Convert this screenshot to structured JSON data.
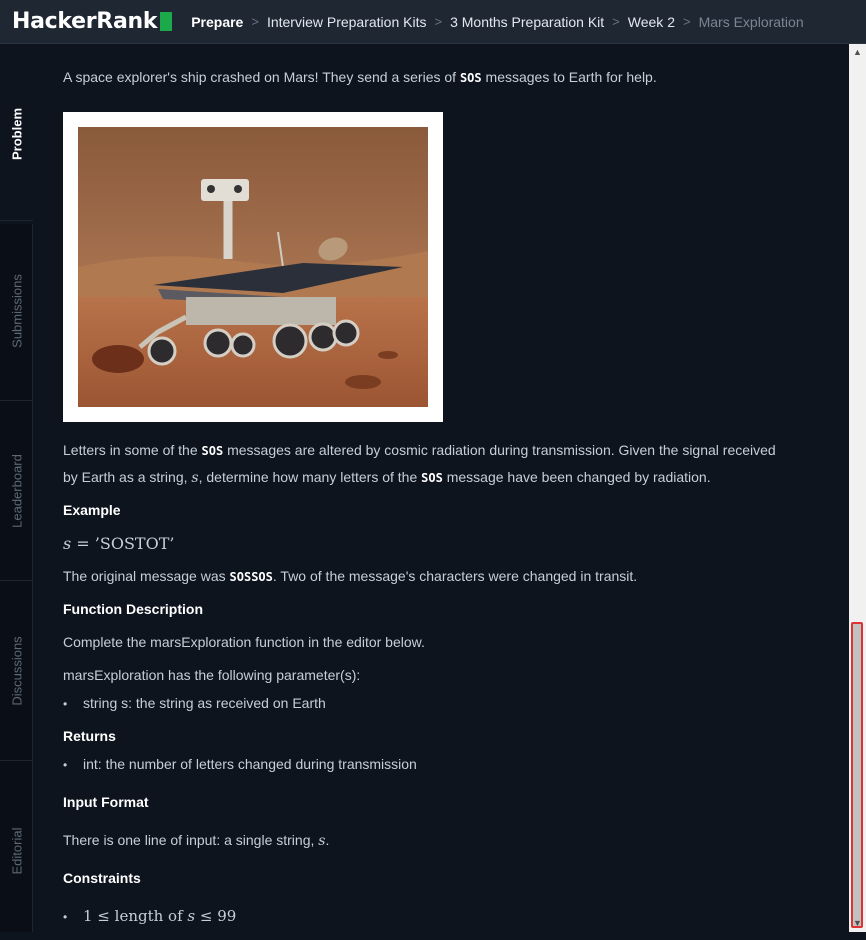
{
  "header": {
    "logo_text": "HackerRank",
    "breadcrumbs": [
      "Prepare",
      "Interview Preparation Kits",
      "3 Months Preparation Kit",
      "Week 2",
      "Mars Exploration"
    ]
  },
  "sidebar": {
    "tabs": [
      "Problem",
      "Submissions",
      "Leaderboard",
      "Discussions",
      "Editorial"
    ],
    "active": "Problem"
  },
  "problem": {
    "intro": [
      "A space explorer's ship crashed on Mars! They send a series of ",
      "SOS",
      " messages to Earth for help."
    ],
    "image_description_icon": "mars-rover-image",
    "para1_line1": [
      "Letters in some of the ",
      "SOS",
      " messages are altered by cosmic radiation during transmission. Given the signal received"
    ],
    "para1_line2": [
      "by Earth as a string, ",
      "s",
      ", determine how many letters of the ",
      "SOS",
      " message have been changed by radiation."
    ],
    "example_heading": "Example",
    "example_math": [
      "s",
      " = ’SOSTOT’"
    ],
    "original_msg": [
      "The original message was ",
      "SOSSOS",
      ". Two of the message's characters were changed in transit."
    ],
    "function_heading": "Function Description",
    "function_desc": "Complete the marsExploration function in the editor below.",
    "params_intro": "marsExploration has the following parameter(s):",
    "param_bullet": "string s: the string as received on Earth",
    "returns_heading": "Returns",
    "returns_bullet": "int: the number of letters changed during transmission",
    "input_heading": "Input Format",
    "input_desc": [
      "There is one line of input: a single string, ",
      "s",
      "."
    ],
    "constraints_heading": "Constraints",
    "constraint": [
      "1 ≤  length of ",
      "s",
      " ≤ 99"
    ],
    "bullet_char": "•"
  },
  "scrollbar": {
    "up_arrow": "▲",
    "down_arrow": "▼"
  }
}
